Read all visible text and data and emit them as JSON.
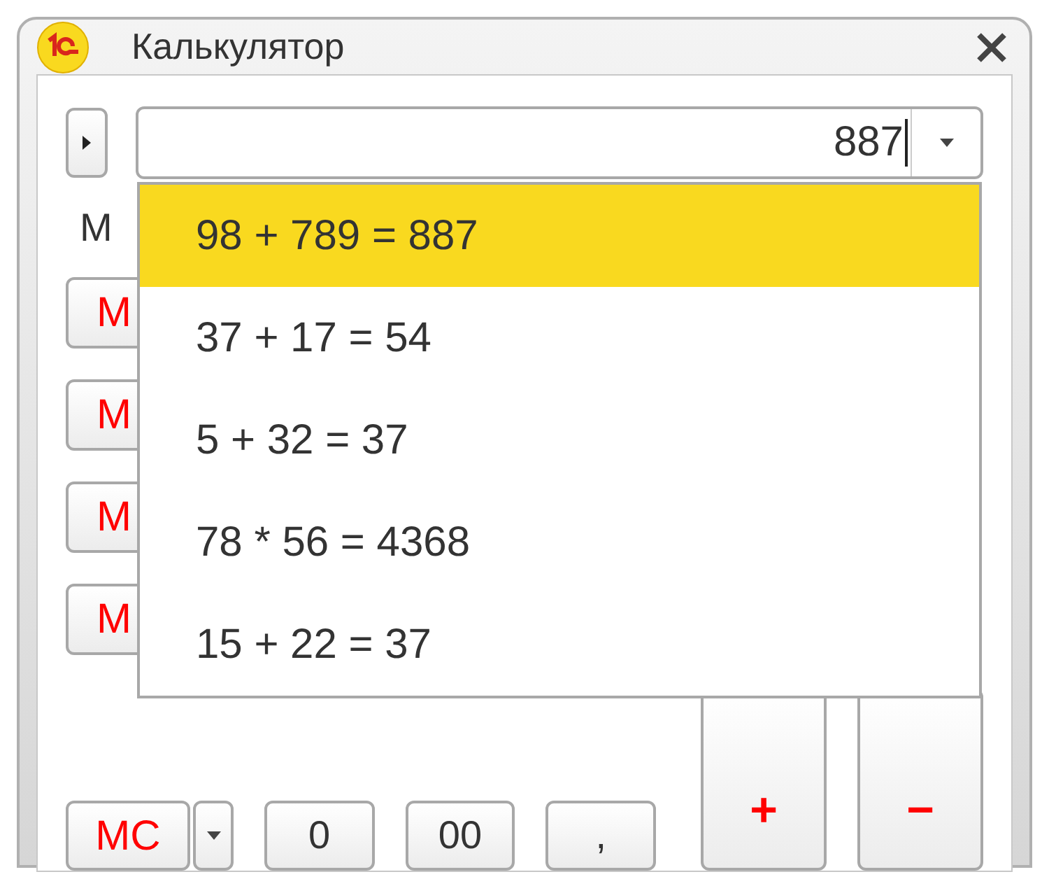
{
  "window": {
    "title": "Калькулятор"
  },
  "display": {
    "value": "887"
  },
  "history": [
    {
      "text": "98 + 789 = 887",
      "selected": true
    },
    {
      "text": "37 + 17 = 54",
      "selected": false
    },
    {
      "text": "5 + 32 = 37",
      "selected": false
    },
    {
      "text": "78 * 56 = 4368",
      "selected": false
    },
    {
      "text": "15 + 22 = 37",
      "selected": false
    }
  ],
  "memory_label": "M",
  "memory_buttons": [
    "M",
    "M",
    "M",
    "M"
  ],
  "bottom_buttons": [
    {
      "label": "MC",
      "kind": "memory"
    },
    {
      "label": "0",
      "kind": "digit"
    },
    {
      "label": "00",
      "kind": "digit"
    },
    {
      "label": ",",
      "kind": "digit"
    }
  ],
  "operators": [
    "+",
    "−"
  ]
}
